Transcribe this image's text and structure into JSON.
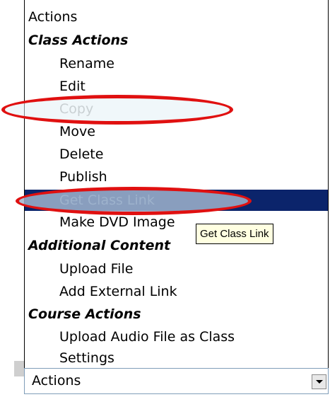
{
  "menu": {
    "header": "Actions",
    "groups": [
      {
        "label": "Class Actions",
        "items": [
          {
            "label": "Rename"
          },
          {
            "label": "Edit"
          },
          {
            "label": "Copy",
            "state": "disabled"
          },
          {
            "label": "Move"
          },
          {
            "label": "Delete"
          },
          {
            "label": "Publish"
          },
          {
            "label": "Get Class Link",
            "state": "selected"
          },
          {
            "label": "Make DVD Image"
          }
        ]
      },
      {
        "label": "Additional Content",
        "items": [
          {
            "label": "Upload File"
          },
          {
            "label": "Add External Link"
          }
        ]
      },
      {
        "label": "Course Actions",
        "items": [
          {
            "label": "Upload Audio File as Class"
          },
          {
            "label": "Settings"
          }
        ]
      }
    ]
  },
  "tooltip": "Get Class Link",
  "combo": {
    "value": "Actions"
  },
  "colors": {
    "highlight": "#0b246b",
    "annotation": "#e01010",
    "tooltip_bg": "#ffffe1"
  }
}
